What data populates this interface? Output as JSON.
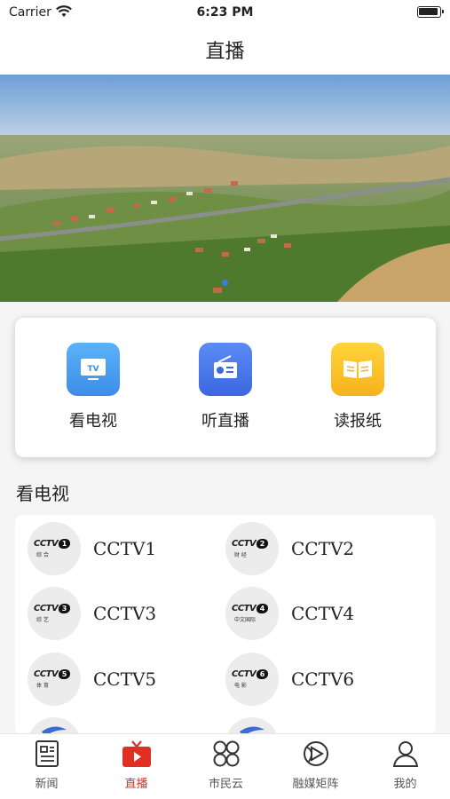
{
  "status_bar": {
    "carrier": "Carrier",
    "time": "6:23 PM"
  },
  "nav": {
    "title": "直播"
  },
  "quick_actions": [
    {
      "label": "看电视",
      "icon": "tv-icon",
      "color": "#4a9ff0"
    },
    {
      "label": "听直播",
      "icon": "radio-icon",
      "color": "#4a78ea"
    },
    {
      "label": "读报纸",
      "icon": "newspaper-icon",
      "color": "#f9c12a"
    }
  ],
  "section": {
    "title": "看电视"
  },
  "channels": [
    {
      "name": "CCTV1",
      "num": "1",
      "sub": "综 合"
    },
    {
      "name": "CCTV2",
      "num": "2",
      "sub": "财 经"
    },
    {
      "name": "CCTV3",
      "num": "3",
      "sub": "综 艺"
    },
    {
      "name": "CCTV4",
      "num": "4",
      "sub": "中文国际"
    },
    {
      "name": "CCTV5",
      "num": "5",
      "sub": "体 育"
    },
    {
      "name": "CCTV6",
      "num": "6",
      "sub": "电 影"
    }
  ],
  "logo_text": "CCTV",
  "tabs": [
    {
      "label": "新闻",
      "icon": "news-icon",
      "active": false
    },
    {
      "label": "直播",
      "icon": "live-tv-icon",
      "active": true
    },
    {
      "label": "市民云",
      "icon": "apps-grid-icon",
      "active": false
    },
    {
      "label": "融媒矩阵",
      "icon": "media-matrix-icon",
      "active": false
    },
    {
      "label": "我的",
      "icon": "profile-icon",
      "active": false
    }
  ],
  "colors": {
    "accent": "#e03024",
    "banner_dot": "#3a7de0"
  }
}
